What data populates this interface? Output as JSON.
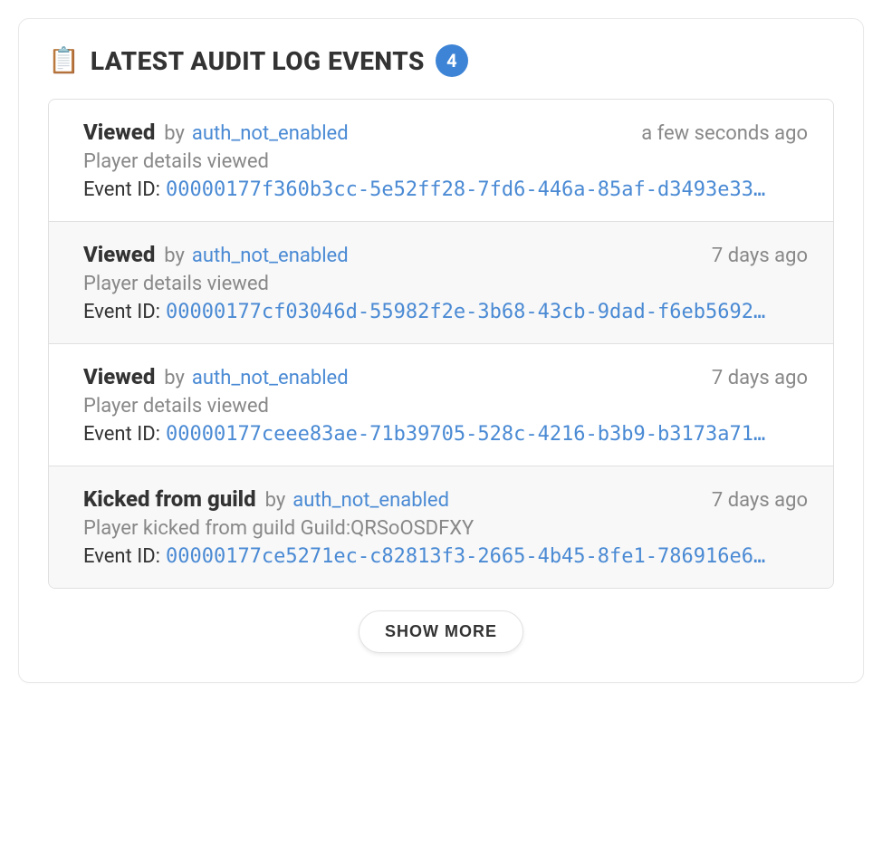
{
  "header": {
    "title": "LATEST AUDIT LOG EVENTS",
    "count": "4",
    "icon": "clipboard-icon"
  },
  "labels": {
    "by": "by",
    "event_id": "Event ID:",
    "show_more": "SHOW MORE"
  },
  "events": [
    {
      "action": "Viewed",
      "actor": "auth_not_enabled",
      "time": "a few seconds ago",
      "description": "Player details viewed",
      "event_id": "00000177f360b3cc-5e52ff28-7fd6-446a-85af-d3493e33…"
    },
    {
      "action": "Viewed",
      "actor": "auth_not_enabled",
      "time": "7 days ago",
      "description": "Player details viewed",
      "event_id": "00000177cf03046d-55982f2e-3b68-43cb-9dad-f6eb5692…"
    },
    {
      "action": "Viewed",
      "actor": "auth_not_enabled",
      "time": "7 days ago",
      "description": "Player details viewed",
      "event_id": "00000177ceee83ae-71b39705-528c-4216-b3b9-b3173a71…"
    },
    {
      "action": "Kicked from guild",
      "actor": "auth_not_enabled",
      "time": "7 days ago",
      "description": "Player kicked from guild Guild:QRSoOSDFXY",
      "event_id": "00000177ce5271ec-c82813f3-2665-4b45-8fe1-786916e6…"
    }
  ]
}
